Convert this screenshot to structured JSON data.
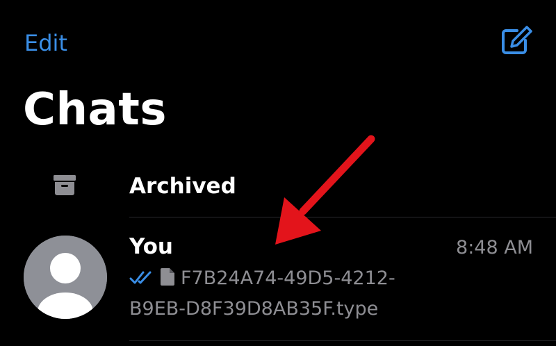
{
  "header": {
    "edit_label": "Edit",
    "compose_icon": "compose-icon",
    "title": "Chats"
  },
  "archived": {
    "icon": "archive-icon",
    "label": "Archived"
  },
  "chats": [
    {
      "name": "You",
      "time": "8:48 AM",
      "status_icon": "double-check-icon",
      "attachment_icon": "document-icon",
      "preview": "F7B24A74-49D5-4212-B9EB-D8F39D8AB35F.type",
      "avatar_icon": "default-avatar-icon"
    }
  ],
  "colors": {
    "background": "#000000",
    "accent": "#3a8ee6",
    "secondary_text": "#8e8e93",
    "annotation_arrow": "#e3141b"
  }
}
